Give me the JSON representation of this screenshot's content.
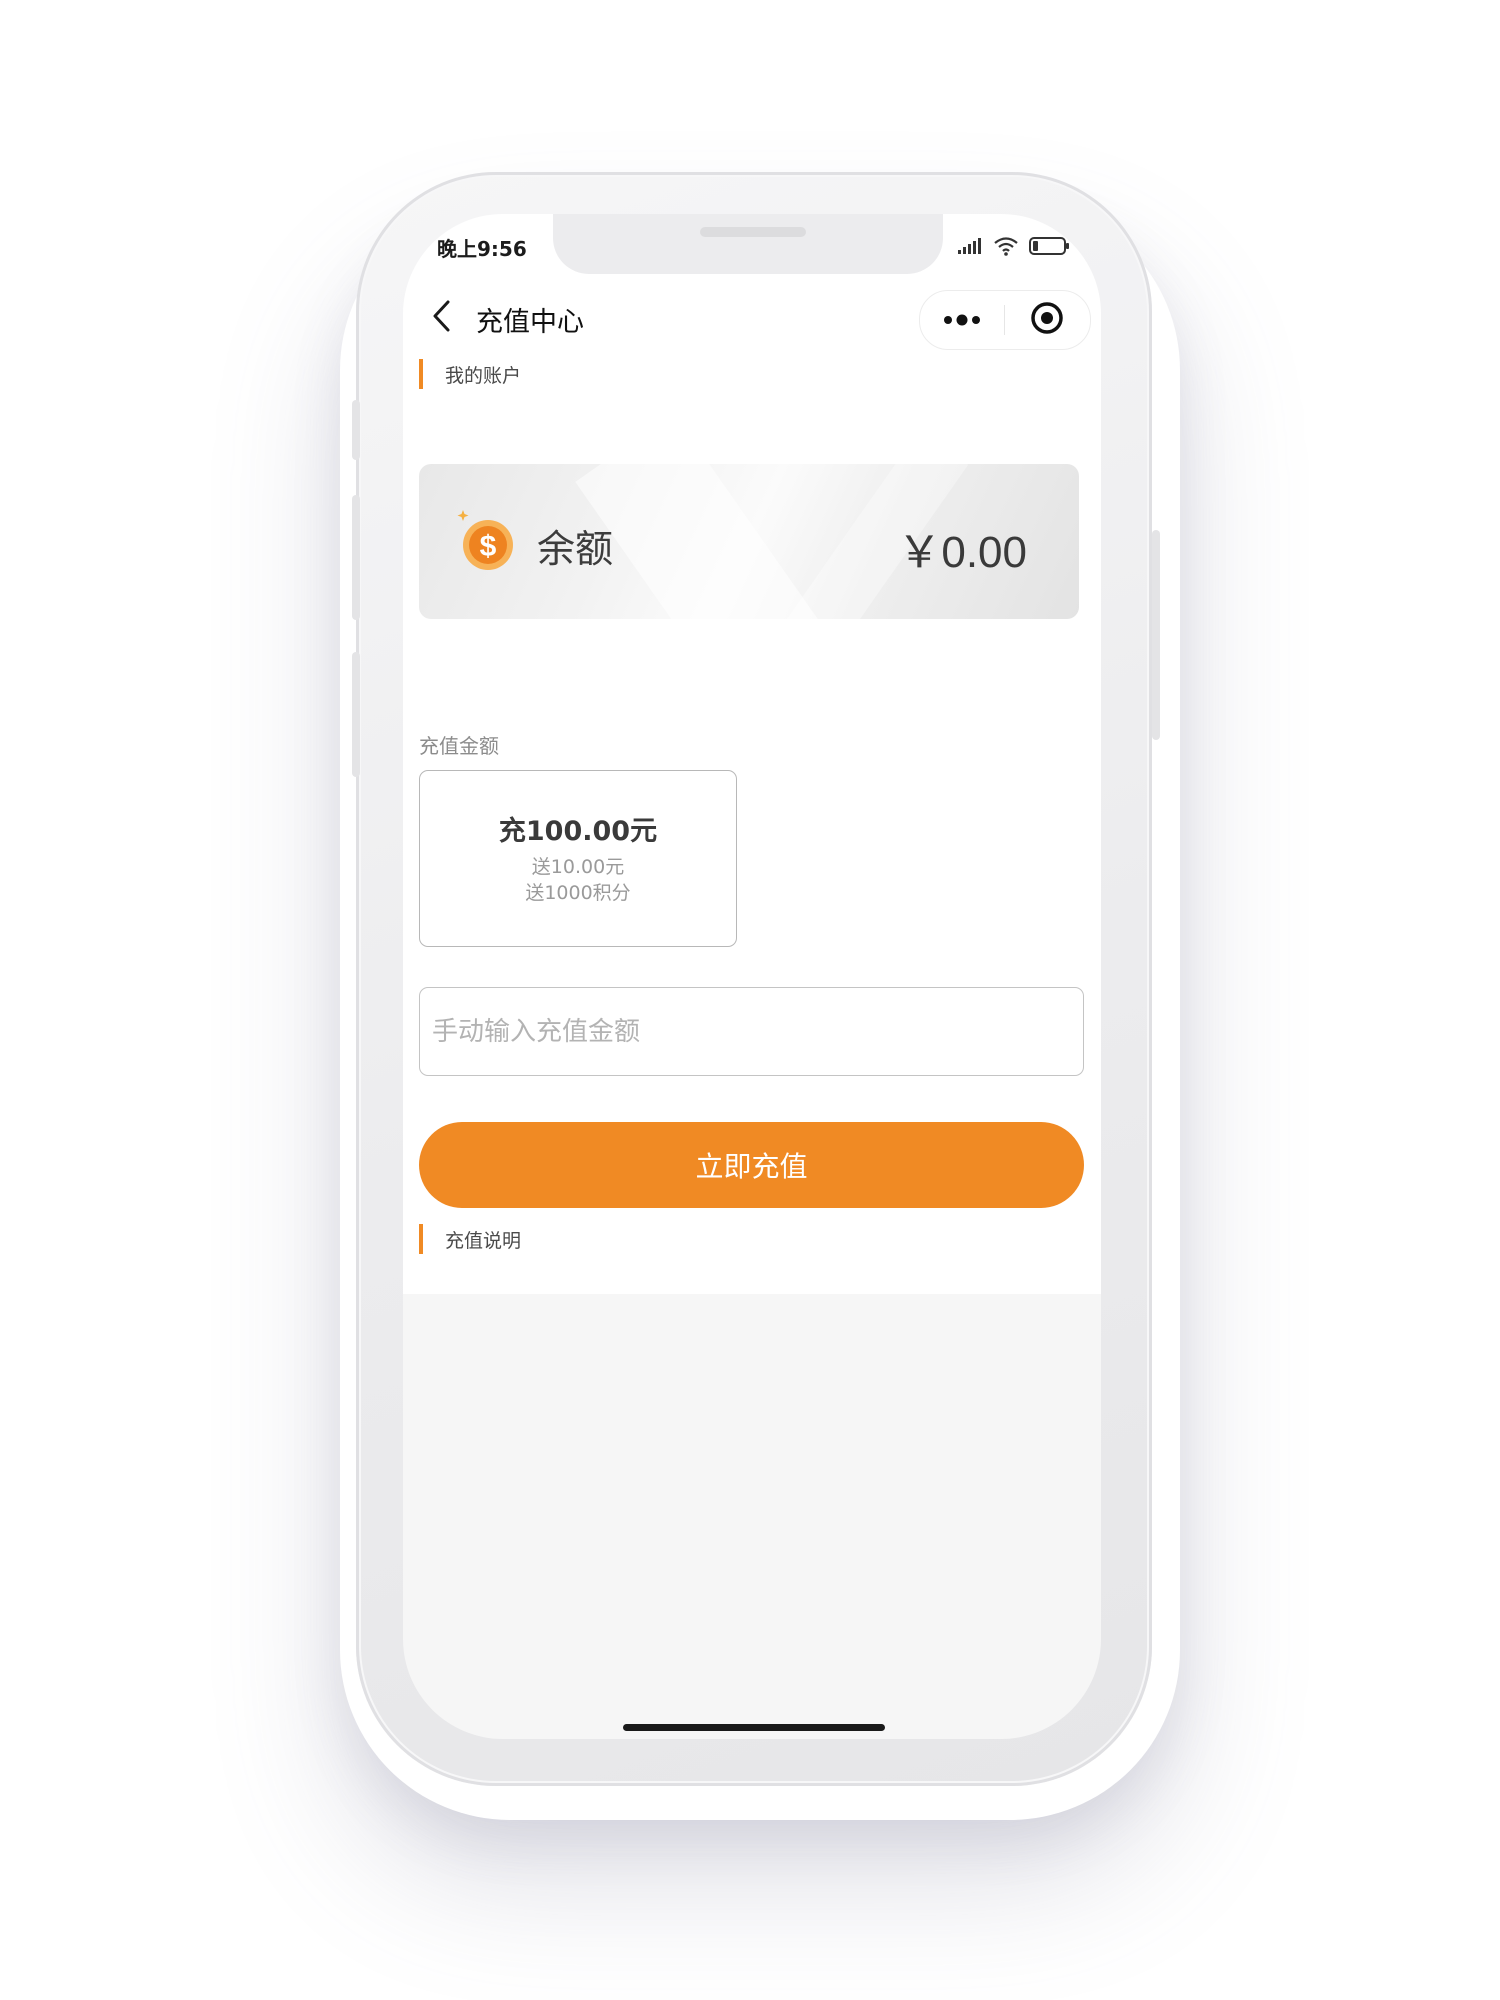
{
  "status_bar": {
    "time": "晚上9:56",
    "signal_icon": "signal-icon",
    "wifi_icon": "wifi-icon",
    "battery_icon": "battery-icon"
  },
  "nav": {
    "back_icon": "chevron-left-icon",
    "title": "充值中心",
    "more_icon": "more-dots-icon",
    "close_icon": "target-circle-icon"
  },
  "account": {
    "section_label": "我的账户",
    "balance_icon": "dollar-coin-icon",
    "balance_label": "余额",
    "balance_value": "￥0.00"
  },
  "recharge": {
    "section_label": "充值金额",
    "options": [
      {
        "main": "充100.00元",
        "bonus_money": "送10.00元",
        "bonus_points": "送1000积分"
      }
    ],
    "input_placeholder": "手动输入充值金额",
    "submit_label": "立即充值"
  },
  "notes": {
    "section_label": "充值说明"
  },
  "colors": {
    "accent": "#f08a24",
    "screen_bg": "#f6f6f6",
    "card_text": "#3a3a3a"
  }
}
